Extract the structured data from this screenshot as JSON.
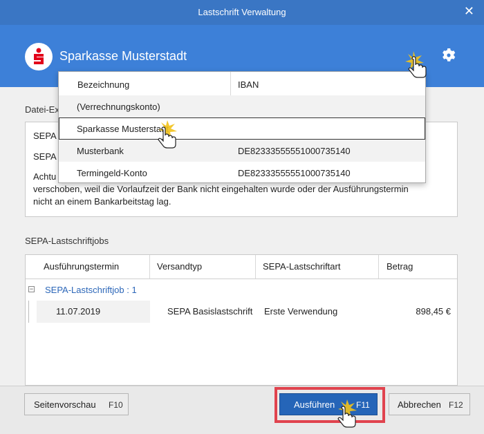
{
  "window": {
    "title": "Lastschrift Verwaltung",
    "close_glyph": "✕"
  },
  "header": {
    "bank_name": "Sparkasse Musterstadt",
    "brand_color": "#3d80d8"
  },
  "section_file": {
    "label": "Datei-Ex"
  },
  "info": {
    "line1": "SEPA L",
    "line2": "SEPA L",
    "line3": "Achtu",
    "line4": "verschoben, weil die Vorlaufzeit der Bank nicht eingehalten wurde oder der Ausführungstermin",
    "line5": "nicht an einem Bankarbeitstag lag."
  },
  "dropdown": {
    "headers": [
      "Bezeichnung",
      "IBAN"
    ],
    "rows": [
      {
        "name": "(Verrechnungskonto)",
        "iban": ""
      },
      {
        "name": "Sparkasse Musterstadt",
        "iban": ""
      },
      {
        "name": "Musterbank",
        "iban": "DE82333555551000735140"
      },
      {
        "name": "Termingeld-Konto",
        "iban": "DE82333555551000735140"
      }
    ]
  },
  "jobs_section": {
    "label": "SEPA-Lastschriftjobs",
    "headers": [
      "Ausführungstermin",
      "Versandtyp",
      "SEPA-Lastschriftart",
      "Betrag"
    ],
    "group": {
      "expander": "−",
      "label": "SEPA-Lastschriftjob : 1"
    },
    "row": {
      "date": "11.07.2019",
      "type": "SEPA Basislastschrift",
      "kind": "Erste Verwendung",
      "amount": "898,45 €"
    }
  },
  "footer": {
    "preview": {
      "label": "Seitenvorschau",
      "key": "F10"
    },
    "execute": {
      "label": "Ausführen",
      "key": "F11"
    },
    "cancel": {
      "label": "Abbrechen",
      "key": "F12"
    }
  },
  "colors": {
    "highlight_frame": "#e0434e",
    "primary_button": "#2565b8",
    "link_text": "#2b66b8"
  }
}
